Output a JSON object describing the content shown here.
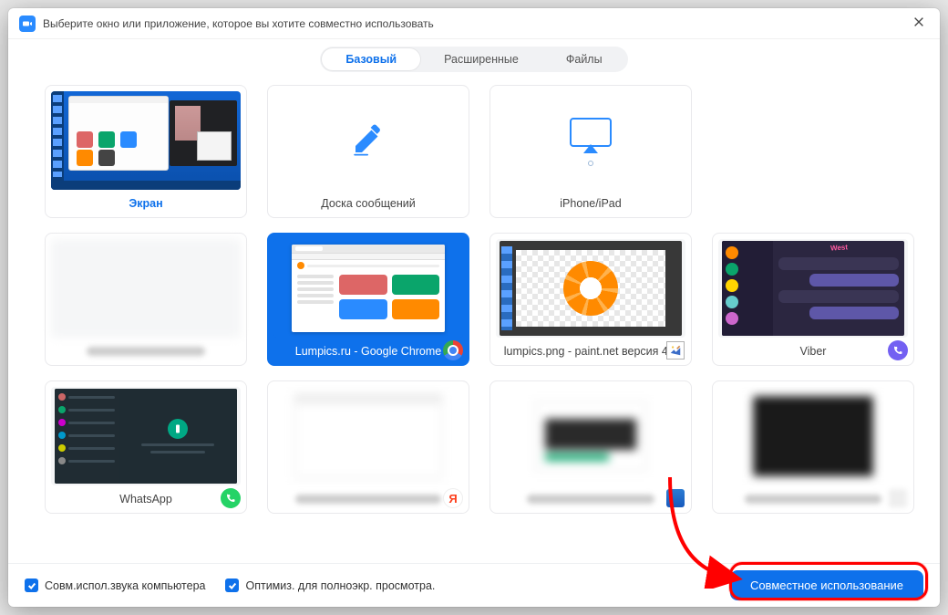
{
  "titlebar": {
    "title": "Выберите окно или приложение, которое вы хотите совместно использовать"
  },
  "tabs": [
    {
      "label": "Базовый",
      "active": true
    },
    {
      "label": "Расширенные",
      "active": false
    },
    {
      "label": "Файлы",
      "active": false
    }
  ],
  "tiles": {
    "screen": {
      "label": "Экран"
    },
    "whiteboard": {
      "label": "Доска сообщений"
    },
    "iphone": {
      "label": "iPhone/iPad"
    },
    "blur1": {
      "label": ""
    },
    "lumpics": {
      "label": "Lumpics.ru - Google Chrome",
      "selected": true
    },
    "paintnet": {
      "label": "lumpics.png - paint.net версия 4..."
    },
    "viber": {
      "label": "Viber",
      "logo_text": "West"
    },
    "whatsapp": {
      "label": "WhatsApp"
    }
  },
  "bottom": {
    "share_audio": "Совм.испол.звука компьютера",
    "optimize": "Оптимиз. для полноэкр. просмотра.",
    "share_btn": "Совместное использование"
  }
}
